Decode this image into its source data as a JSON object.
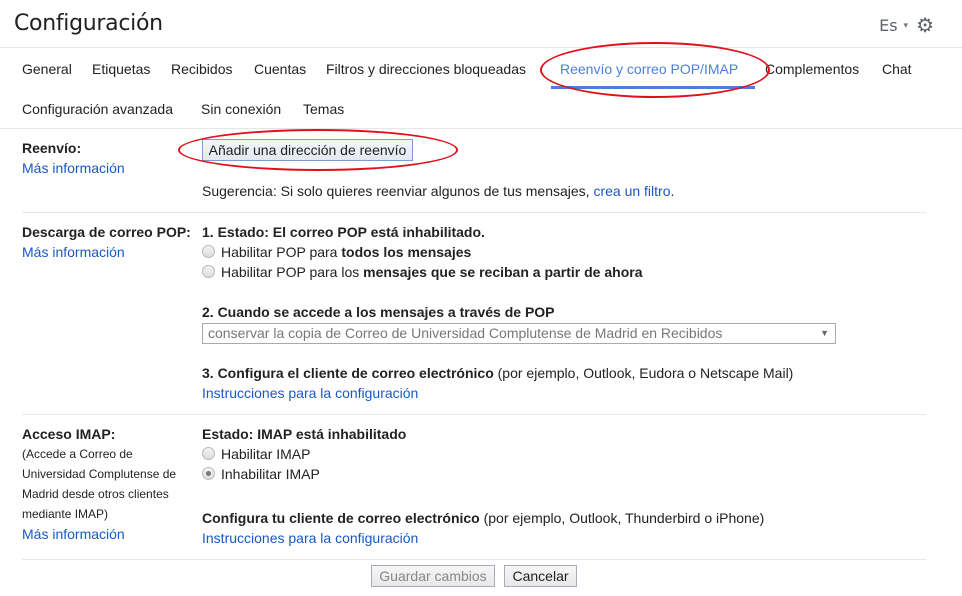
{
  "header": {
    "title": "Configuración",
    "language": "Es",
    "language_caret": "▾",
    "settings_icon": "⚙"
  },
  "tabs": [
    {
      "label": "General",
      "active": false
    },
    {
      "label": "Etiquetas",
      "active": false
    },
    {
      "label": "Recibidos",
      "active": false
    },
    {
      "label": "Cuentas",
      "active": false
    },
    {
      "label": "Filtros y direcciones bloqueadas",
      "active": false
    },
    {
      "label": "Reenvío y correo POP/IMAP",
      "active": true
    },
    {
      "label": "Complementos",
      "active": false
    },
    {
      "label": "Chat",
      "active": false
    },
    {
      "label": "Configuración avanzada",
      "active": false
    },
    {
      "label": "Sin conexión",
      "active": false
    },
    {
      "label": "Temas",
      "active": false
    }
  ],
  "colors": {
    "accent": "#4a7fe0",
    "link": "#1a57c8",
    "annotation": "#e0111c"
  },
  "forwarding": {
    "label": "Reenvío:",
    "more_info": "Más información",
    "add_button": "Añadir una dirección de reenvío",
    "tip_prefix": "Sugerencia: Si solo quieres reenviar algunos de tus mensajes, ",
    "tip_link": "crea un filtro",
    "tip_suffix": "."
  },
  "pop": {
    "label": "Descarga de correo POP:",
    "more_info": "Más información",
    "status": "1. Estado: El correo POP está inhabilitado.",
    "options": [
      {
        "prefix": "Habilitar POP para ",
        "bold": "todos los mensajes",
        "selected": false
      },
      {
        "prefix": "Habilitar POP para los ",
        "bold": "mensajes que se reciban a partir de ahora",
        "selected": false
      }
    ],
    "when_accessed": "2. Cuando se accede a los mensajes a través de POP",
    "select_value": "conservar la copia de Correo de Universidad Complutense de Madrid en Recibidos",
    "configure_bold": "3. Configura el cliente de correo electrónico",
    "configure_rest": " (por ejemplo, Outlook, Eudora o Netscape Mail)",
    "instructions": "Instrucciones para la configuración"
  },
  "imap": {
    "label": "Acceso IMAP:",
    "description_lines": [
      "(Accede a Correo de",
      "Universidad Complutense de",
      "Madrid desde otros clientes",
      "mediante IMAP)"
    ],
    "more_info": "Más información",
    "status": "Estado: IMAP está inhabilitado",
    "options": [
      {
        "label": "Habilitar IMAP",
        "selected": false
      },
      {
        "label": "Inhabilitar IMAP",
        "selected": true
      }
    ],
    "configure_bold": "Configura tu cliente de correo electrónico",
    "configure_rest": " (por ejemplo, Outlook, Thunderbird o iPhone)",
    "instructions": "Instrucciones para la configuración"
  },
  "footer": {
    "save": "Guardar cambios",
    "cancel": "Cancelar"
  }
}
